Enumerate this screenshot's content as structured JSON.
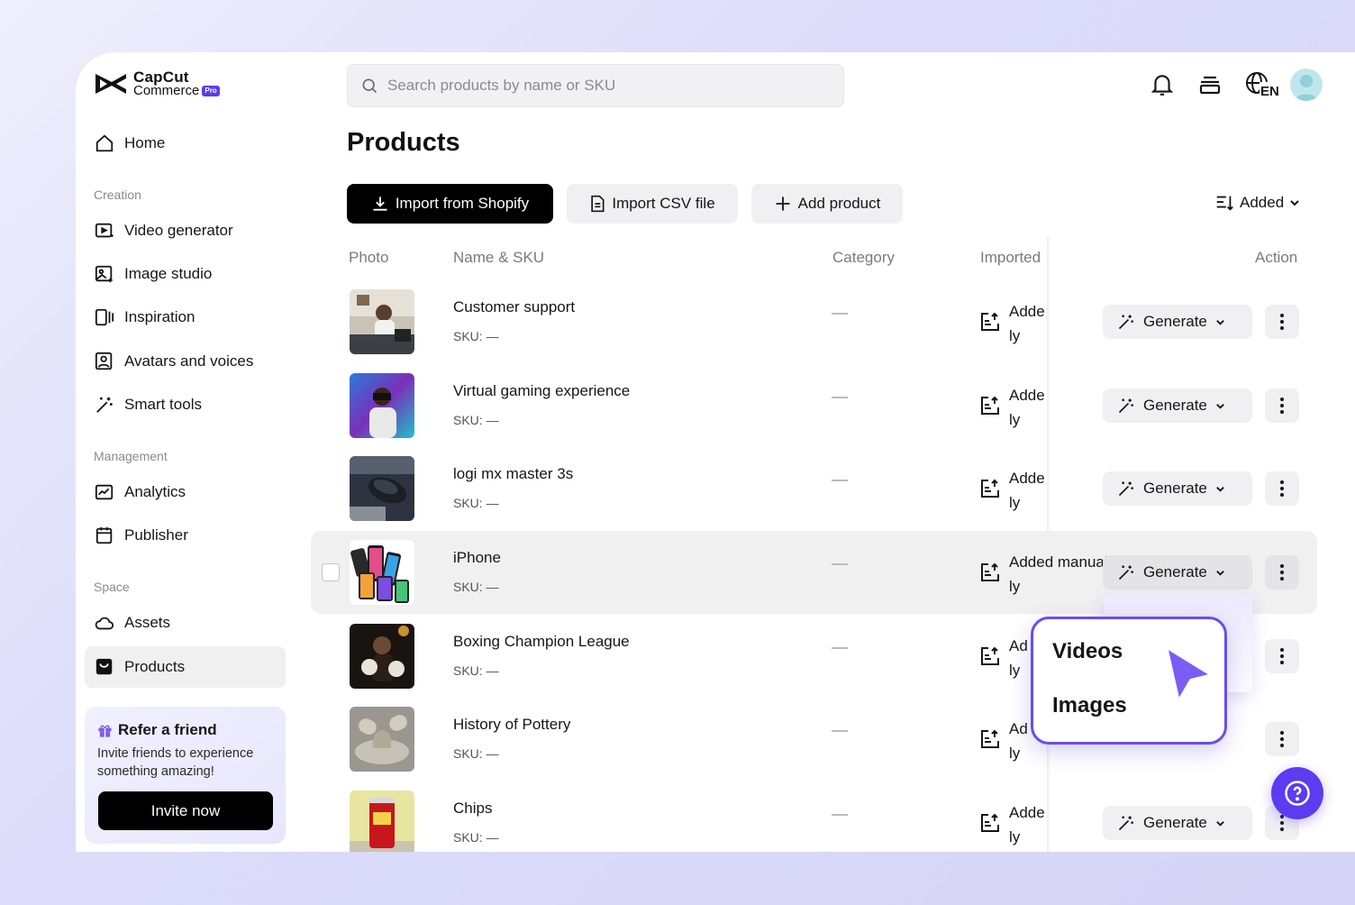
{
  "app": {
    "brand_line1": "CapCut",
    "brand_line2": "Commerce",
    "badge": "Pro"
  },
  "search": {
    "placeholder": "Search products by name or SKU"
  },
  "header_icons": [
    "bell-icon",
    "stack-icon",
    "globe-language-icon",
    "avatar"
  ],
  "language": "EN",
  "sidebar": {
    "home": "Home",
    "sections": [
      {
        "label": "Creation",
        "items": [
          "Video generator",
          "Image studio",
          "Inspiration",
          "Avatars and voices",
          "Smart tools"
        ]
      },
      {
        "label": "Management",
        "items": [
          "Analytics",
          "Publisher"
        ]
      },
      {
        "label": "Space",
        "items": [
          "Assets",
          "Products"
        ]
      }
    ],
    "active": "Products",
    "refer": {
      "title": "Refer a friend",
      "desc": "Invite friends to experience something amazing!",
      "button": "Invite now"
    }
  },
  "page": {
    "title": "Products",
    "buttons": {
      "import_shopify": "Import from Shopify",
      "import_csv": "Import CSV file",
      "add_product": "Add product"
    },
    "sort": "Added"
  },
  "table": {
    "headers": {
      "photo": "Photo",
      "name": "Name & SKU",
      "category": "Category",
      "imported": "Imported",
      "action": "Action"
    },
    "rows": [
      {
        "name": "Customer support",
        "sku": "SKU: —",
        "imported_l1": "Adde",
        "imported_l2": "ly",
        "generate": "Generate"
      },
      {
        "name": "Virtual gaming experience",
        "sku": "SKU: —",
        "imported_l1": "Adde",
        "imported_l2": "ly",
        "generate": "Generate"
      },
      {
        "name": "logi mx master 3s",
        "sku": "SKU: —",
        "imported_l1": "Adde",
        "imported_l2": "ly",
        "generate": "Generate"
      },
      {
        "name": "iPhone",
        "sku": "SKU: —",
        "imported_l1": "Added manual",
        "imported_l2": "ly",
        "generate": "Generate"
      },
      {
        "name": "Boxing Champion League",
        "sku": "SKU: —",
        "imported_l1": "Ad",
        "imported_l2": "ly",
        "generate": ""
      },
      {
        "name": "History of Pottery",
        "sku": "SKU: —",
        "imported_l1": "Ad",
        "imported_l2": "ly",
        "generate": ""
      },
      {
        "name": "Chips",
        "sku": "SKU: —",
        "imported_l1": "Adde",
        "imported_l2": "ly",
        "generate": "Generate"
      }
    ]
  },
  "dropdown": {
    "items": [
      "Videos",
      "Images"
    ]
  },
  "colors": {
    "accent": "#5b3cf0",
    "dropdown_border": "#6b4cf3",
    "dark_button": "#000000"
  }
}
